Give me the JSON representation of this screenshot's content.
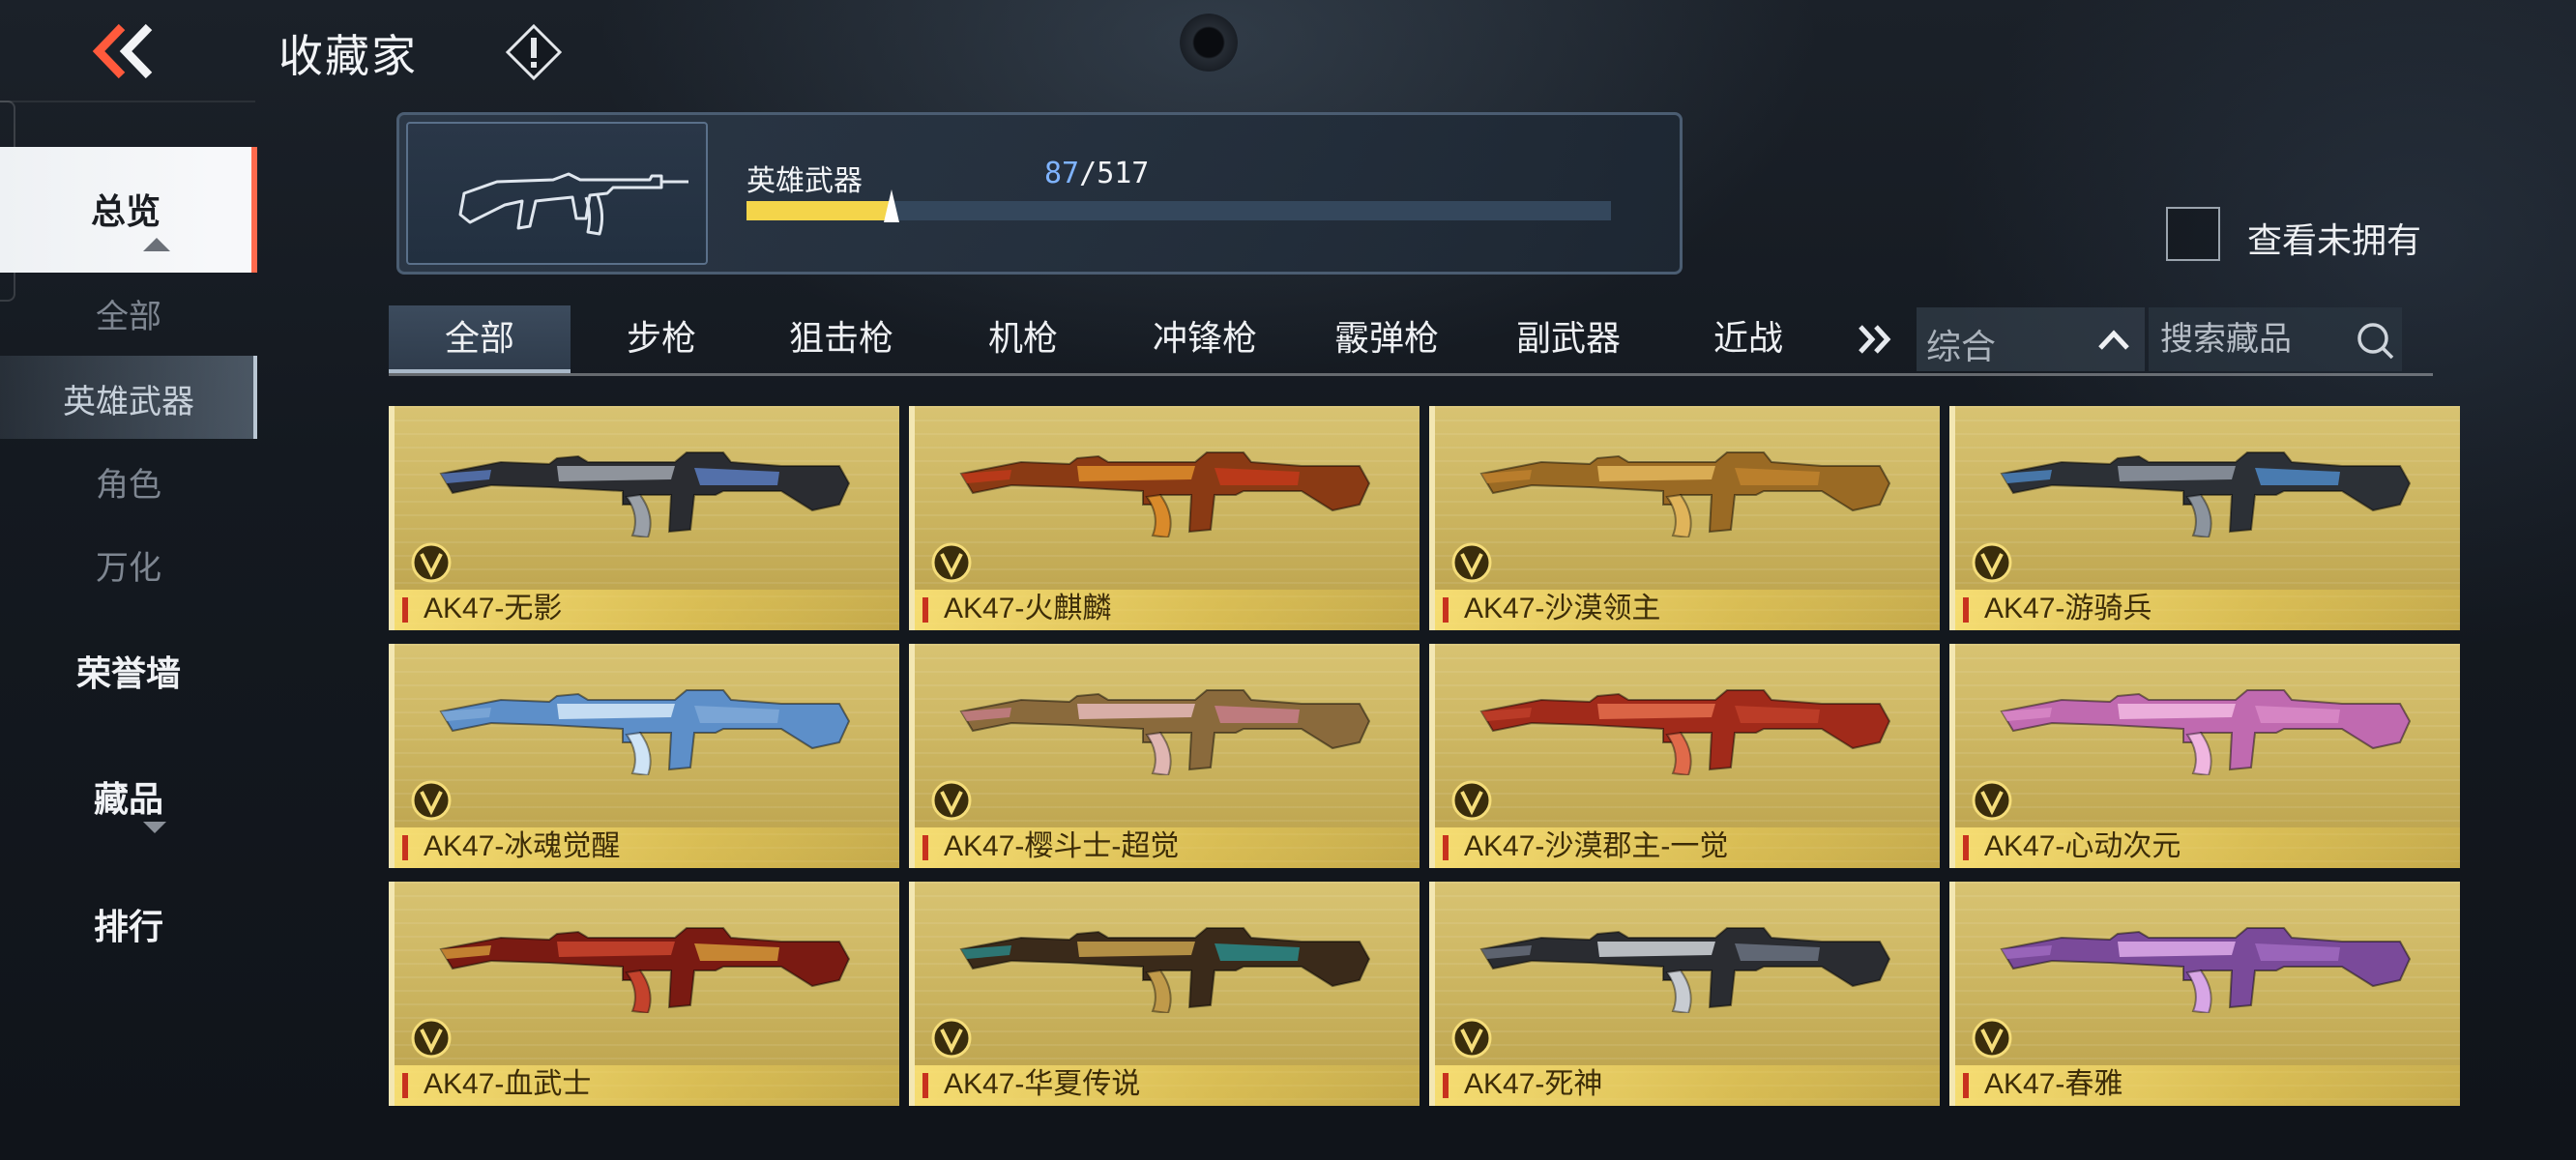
{
  "header": {
    "title": "收藏家"
  },
  "sidebar": {
    "overview": "总览",
    "sub_items": [
      "全部",
      "英雄武器",
      "角色",
      "万化"
    ],
    "honor_wall": "荣誉墙",
    "collection": "藏品",
    "ranking": "排行"
  },
  "progress": {
    "label": "英雄武器",
    "owned": "87",
    "separator": "/",
    "total": "517",
    "fraction": 0.168
  },
  "filter": {
    "show_unowned_label": "查看未拥有",
    "show_unowned_checked": false
  },
  "tabs": [
    "全部",
    "步枪",
    "狙击枪",
    "机枪",
    "冲锋枪",
    "霰弹枪",
    "副武器",
    "近战"
  ],
  "sort": {
    "selected": "综合"
  },
  "search": {
    "placeholder": "搜索藏品"
  },
  "items": [
    {
      "name": "AK47-无影",
      "palette": [
        "#2a2c31",
        "#9aa0a8",
        "#5a7cc0"
      ]
    },
    {
      "name": "AK47-火麒麟",
      "palette": [
        "#8a3a14",
        "#d98a2a",
        "#c23a1a"
      ]
    },
    {
      "name": "AK47-沙漠领主",
      "palette": [
        "#9a6a24",
        "#e0b45a",
        "#c0822e"
      ]
    },
    {
      "name": "AK47-游骑兵",
      "palette": [
        "#2c3036",
        "#8c949e",
        "#4f88c6"
      ]
    },
    {
      "name": "AK47-冰魂觉醒",
      "palette": [
        "#5d8fc9",
        "#cfe4f6",
        "#7fa9d8"
      ]
    },
    {
      "name": "AK47-樱斗士-超觉",
      "palette": [
        "#8a6a3c",
        "#e0b6b2",
        "#c77e8a"
      ]
    },
    {
      "name": "AK47-沙漠郡主-一觉",
      "palette": [
        "#a12a1a",
        "#e06a4a",
        "#c0402a"
      ]
    },
    {
      "name": "AK47-心动次元",
      "palette": [
        "#c06ab0",
        "#f0b6e0",
        "#d98ac8"
      ]
    },
    {
      "name": "AK47-血武士",
      "palette": [
        "#7a1a12",
        "#c4422c",
        "#d49a3a"
      ]
    },
    {
      "name": "AK47-华夏传说",
      "palette": [
        "#3a2a1a",
        "#c09a4a",
        "#2a8a8a"
      ]
    },
    {
      "name": "AK47-死神",
      "palette": [
        "#2a2c31",
        "#c8ccd2",
        "#6a7280"
      ]
    },
    {
      "name": "AK47-春雅",
      "palette": [
        "#7a4a9a",
        "#d8a6e6",
        "#a06ac0"
      ]
    }
  ],
  "colors": {
    "accent": "#ff6a4d",
    "progress": "#f4d54a",
    "owned_count": "#7fb3ff",
    "card_gold": "#c9b25d"
  },
  "icons": {
    "back": "double-chevron-left-icon",
    "info": "exclamation-diamond-icon",
    "more_tabs": "double-chevron-right-icon",
    "sort": "chevron-up-icon",
    "search": "search-icon",
    "badge": "v-badge-icon"
  }
}
